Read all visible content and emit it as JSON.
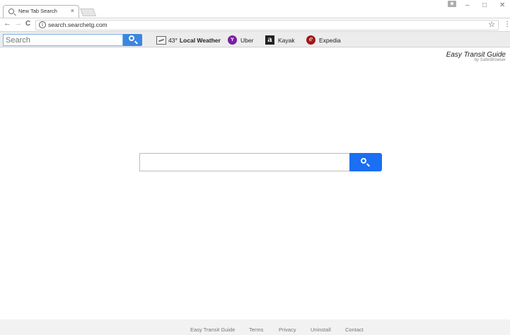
{
  "browser": {
    "tab_title": "New Tab Search",
    "tab_close": "×",
    "url": "search.searchetg.com",
    "window_controls": {
      "minimize": "–",
      "maximize": "□",
      "close": "✕"
    },
    "nav": {
      "back": "←",
      "forward": "→",
      "reload": "C"
    },
    "info_glyph": "i",
    "star_glyph": "☆",
    "menu_glyph": "⋮"
  },
  "toolbar": {
    "search_placeholder": "Search",
    "weather_temp": "43°",
    "weather_label": "Local Weather",
    "uber_icon_letter": "Y",
    "uber_label": "Uber",
    "kayak_icon_letter": "a",
    "kayak_label": "Kayak",
    "expedia_icon_letter": "e",
    "expedia_label": "Expedia"
  },
  "brand": {
    "title": "Easy Transit Guide",
    "subtitle": "by SaferBrowser"
  },
  "main": {
    "search_placeholder": ""
  },
  "footer": {
    "links": [
      "Easy Transit Guide",
      "Terms",
      "Privacy",
      "Uninstall",
      "Contact"
    ]
  },
  "colors": {
    "toolbar_search_button": "#3a86e0",
    "main_search_button": "#1a6ff2",
    "uber_icon": "#7b1fa2",
    "expedia_icon": "#a01818"
  }
}
